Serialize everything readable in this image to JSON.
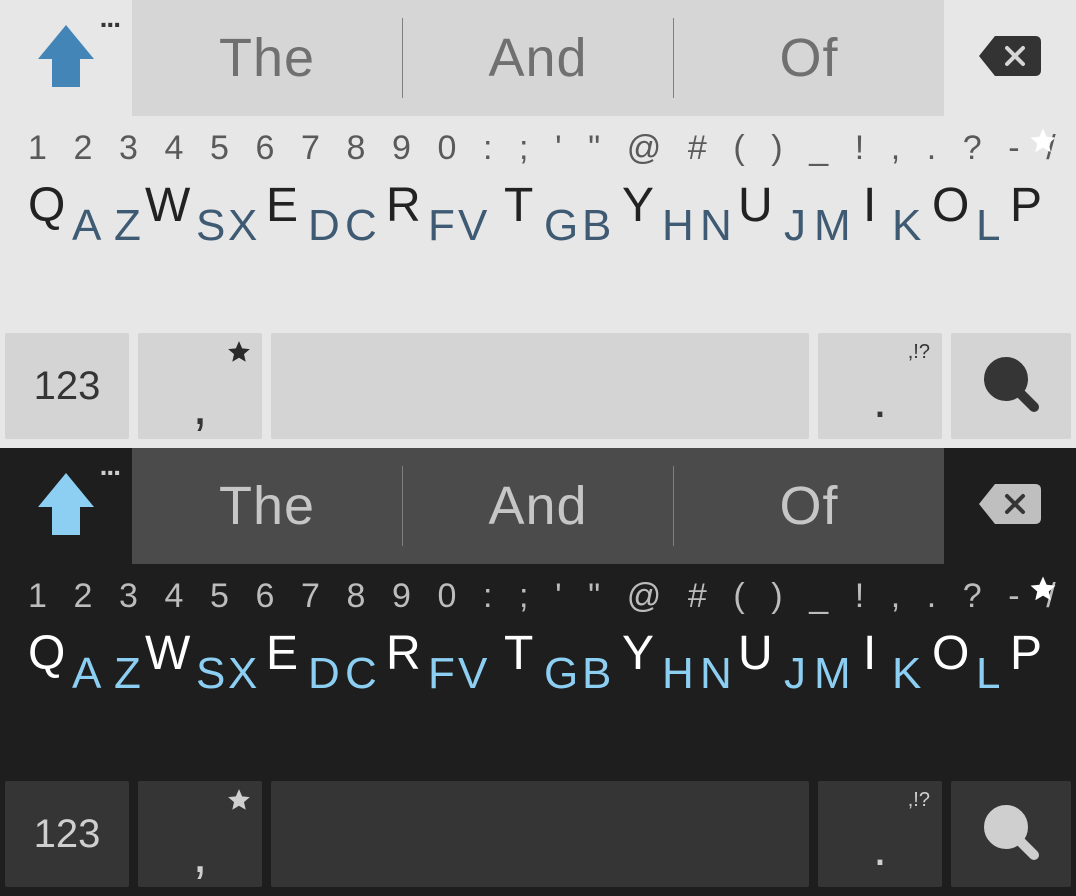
{
  "themes": [
    "light",
    "dark"
  ],
  "suggestion_bar": {
    "items": [
      "The",
      "And",
      "Of"
    ]
  },
  "number_row": [
    "1",
    "2",
    "3",
    "4",
    "5",
    "6",
    "7",
    "8",
    "9",
    "0",
    ":",
    ";",
    "'",
    "\"",
    "@",
    "#",
    "(",
    ")",
    "_",
    "!",
    ",",
    ".",
    "?",
    "-",
    "/"
  ],
  "letter_row": [
    {
      "p": "Q",
      "s": "A"
    },
    {
      "p": "Z",
      "s": ""
    },
    {
      "p": "W",
      "s": "S"
    },
    {
      "p": "X",
      "s": ""
    },
    {
      "p": "E",
      "s": "D"
    },
    {
      "p": "C",
      "s": ""
    },
    {
      "p": "R",
      "s": "F"
    },
    {
      "p": "V",
      "s": ""
    },
    {
      "p": "T",
      "s": "G"
    },
    {
      "p": "B",
      "s": ""
    },
    {
      "p": "Y",
      "s": "H"
    },
    {
      "p": "N",
      "s": ""
    },
    {
      "p": "U",
      "s": "J"
    },
    {
      "p": "M",
      "s": ""
    },
    {
      "p": "I",
      "s": "K"
    },
    {
      "p": "O",
      "s": "L"
    },
    {
      "p": "P",
      "s": ""
    }
  ],
  "bottom_row": {
    "numeric_label": "123",
    "comma": ",",
    "comma_super": "★",
    "period": ".",
    "period_super": ",!?"
  },
  "icons": {
    "shift": "shift-icon",
    "backspace": "backspace-icon",
    "star": "star-icon",
    "search": "search-icon",
    "ellipsis": "..."
  }
}
